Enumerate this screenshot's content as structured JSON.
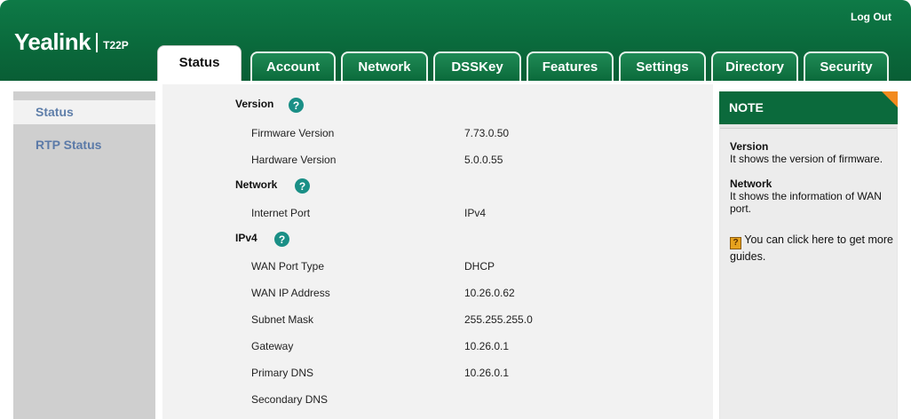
{
  "header": {
    "logout": "Log Out",
    "brand": "Yealink",
    "model": "T22P"
  },
  "tabs": [
    {
      "label": "Status"
    },
    {
      "label": "Account"
    },
    {
      "label": "Network"
    },
    {
      "label": "DSSKey"
    },
    {
      "label": "Features"
    },
    {
      "label": "Settings"
    },
    {
      "label": "Directory"
    },
    {
      "label": "Security"
    }
  ],
  "sidebar": {
    "items": [
      {
        "label": "Status"
      },
      {
        "label": "RTP Status"
      }
    ]
  },
  "main": {
    "sections": {
      "version": "Version",
      "network": "Network",
      "ipv4": "IPv4"
    },
    "help_glyph": "?",
    "rows": [
      {
        "label": "Firmware Version",
        "value": "7.73.0.50"
      },
      {
        "label": "Hardware Version",
        "value": "5.0.0.55"
      },
      {
        "label": "Internet Port",
        "value": "IPv4"
      },
      {
        "label": "WAN Port Type",
        "value": "DHCP"
      },
      {
        "label": "WAN IP Address",
        "value": "10.26.0.62"
      },
      {
        "label": "Subnet Mask",
        "value": "255.255.255.0"
      },
      {
        "label": "Gateway",
        "value": "10.26.0.1"
      },
      {
        "label": "Primary DNS",
        "value": "10.26.0.1"
      },
      {
        "label": "Secondary DNS",
        "value": ""
      }
    ]
  },
  "note": {
    "title": "NOTE",
    "version_title": "Version",
    "version_text": "It shows the version of firmware.",
    "network_title": "Network",
    "network_text": "It shows the information of WAN port.",
    "guide_text": "You can click here to get more guides."
  },
  "colors": {
    "brand_green": "#0b6a3c",
    "accent_orange": "#f28a1e",
    "help_teal": "#1a8f86",
    "sidebar_link": "#5b7aa8"
  }
}
